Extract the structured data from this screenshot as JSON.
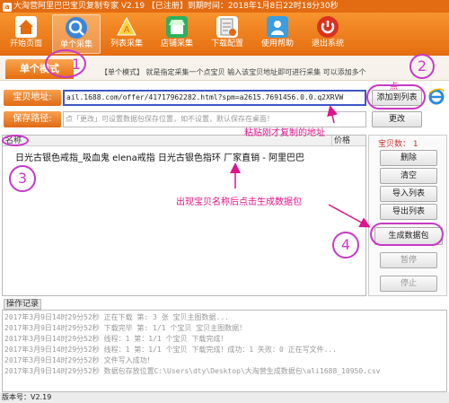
{
  "title": "大淘营阿里巴巴宝贝复制专家 V2.19 【已注册】到期时间：2018年1月8日22时18分30秒",
  "toolbar": {
    "items": [
      {
        "label": "开始页面",
        "icon": "home-icon"
      },
      {
        "label": "单个采集",
        "icon": "single-collect-icon"
      },
      {
        "label": "列表采集",
        "icon": "list-collect-icon"
      },
      {
        "label": "店铺采集",
        "icon": "shop-collect-icon"
      },
      {
        "label": "下载配置",
        "icon": "download-config-icon"
      },
      {
        "label": "使用帮助",
        "icon": "help-icon"
      },
      {
        "label": "退出系统",
        "icon": "exit-icon"
      }
    ]
  },
  "mode": {
    "tab": "单个模式",
    "tip": "【单个模式】 就是指定采集一个点宝贝 输入该宝贝地址即可进行采集 可以添加多个"
  },
  "form": {
    "url_label": "宝贝地址:",
    "url_value": "ail.1688.com/offer/41717962282.html?spm=a2615.7691456.0.0.q2XRVW",
    "add_button": "添加到列表",
    "path_label": "保存路径:",
    "path_placeholder": "点「更改」可设置数据包保存位置，如不设置，默认保存在桌面！",
    "change_button": "更改"
  },
  "list": {
    "col_name": "名称",
    "col_price": "价格",
    "rows": [
      "日光古银色戒指_吸血鬼 elena戒指 日光古银色指环 厂家直销 - 阿里巴巴"
    ]
  },
  "side": {
    "count": "宝贝数：  1",
    "buttons": [
      "删除",
      "清空",
      "导入列表",
      "导出列表"
    ],
    "generate": "生成数据包",
    "pause": "暂停",
    "stop": "停止"
  },
  "log": {
    "title": "操作记录",
    "lines": [
      "2017年3月9日14时29分52秒  正在下载 第: 3  张 宝贝主图数据...",
      "2017年3月9日14时29分52秒  下载完毕 第: 1/1  个宝贝  宝贝主图数据！",
      "2017年3月9日14时29分52秒  线程：1 第：1/1  个宝贝  下载完成！",
      "2017年3月9日14时29分52秒  线程：1 第：1/1  个宝贝  下载完成！成功：1  失败：0  正在写文件...",
      "2017年3月9日14时29分52秒  文件写入成功！",
      "2017年3月9日14时29分52秒  数据包存放位置C:\\Users\\dty\\Desktop\\大淘营生成数据包\\ali1688_10950.csv"
    ]
  },
  "status": "版本号：V2.19",
  "annotations": {
    "paste_hint": "粘贴刚才复制的地址",
    "click_hint": "点",
    "generate_hint": "出现宝贝名称后点击生成数据包",
    "n1": "1",
    "n2": "2",
    "n3": "3",
    "n4": "4"
  },
  "colors": {
    "accent": "#e36b11",
    "annotation": "#e0138a",
    "circle": "#c739c7"
  }
}
